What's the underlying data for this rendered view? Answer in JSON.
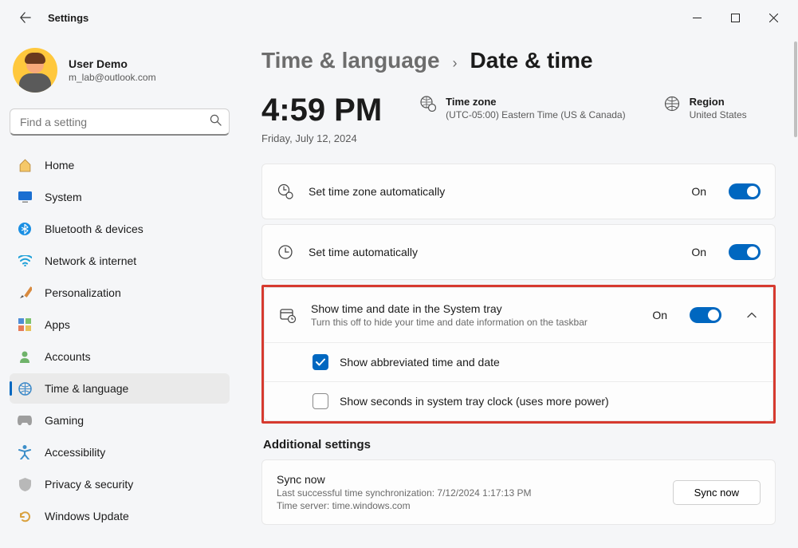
{
  "window": {
    "title": "Settings"
  },
  "user": {
    "name": "User Demo",
    "email": "m_lab@outlook.com"
  },
  "search": {
    "placeholder": "Find a setting"
  },
  "sidebar": {
    "items": [
      {
        "label": "Home"
      },
      {
        "label": "System"
      },
      {
        "label": "Bluetooth & devices"
      },
      {
        "label": "Network & internet"
      },
      {
        "label": "Personalization"
      },
      {
        "label": "Apps"
      },
      {
        "label": "Accounts"
      },
      {
        "label": "Time & language"
      },
      {
        "label": "Gaming"
      },
      {
        "label": "Accessibility"
      },
      {
        "label": "Privacy & security"
      },
      {
        "label": "Windows Update"
      }
    ]
  },
  "breadcrumb": {
    "parent": "Time & language",
    "current": "Date & time"
  },
  "clock": {
    "time": "4:59 PM",
    "date": "Friday, July 12, 2024"
  },
  "timezone": {
    "label": "Time zone",
    "value": "(UTC-05:00) Eastern Time (US & Canada)"
  },
  "region": {
    "label": "Region",
    "value": "United States"
  },
  "settings": {
    "auto_tz": {
      "label": "Set time zone automatically",
      "state": "On"
    },
    "auto_time": {
      "label": "Set time automatically",
      "state": "On"
    },
    "tray": {
      "label": "Show time and date in the System tray",
      "sub": "Turn this off to hide your time and date information on the taskbar",
      "state": "On",
      "abbrev": "Show abbreviated time and date",
      "seconds": "Show seconds in system tray clock (uses more power)"
    }
  },
  "additional": {
    "heading": "Additional settings",
    "sync": {
      "title": "Sync now",
      "line1": "Last successful time synchronization: 7/12/2024 1:17:13 PM",
      "line2": "Time server: time.windows.com",
      "button": "Sync now"
    }
  }
}
